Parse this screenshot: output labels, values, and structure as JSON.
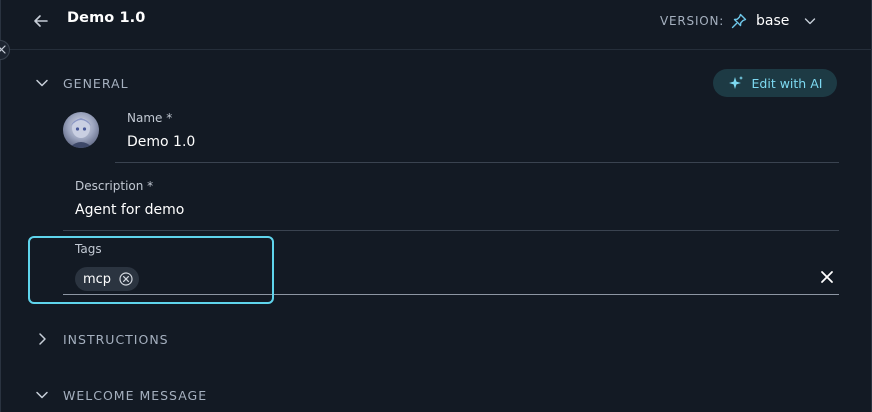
{
  "header": {
    "title": "Demo 1.0",
    "version_label": "VERSION:",
    "version_value": "base",
    "back_icon": "arrow-left-icon",
    "pin_icon": "pin-icon",
    "dropdown_icon": "chevron-down-icon"
  },
  "sections": {
    "general": "GENERAL",
    "instructions": "INSTRUCTIONS",
    "welcome": "WELCOME MESSAGE"
  },
  "edit_ai_label": "Edit with AI",
  "fields": {
    "name_label": "Name *",
    "name_value": "Demo 1.0",
    "description_label": "Description *",
    "description_value": "Agent for demo",
    "tags_label": "Tags",
    "tags": [
      "mcp"
    ]
  },
  "colors": {
    "background": "#131a24",
    "accent": "#5fd4ec",
    "ai_button_bg": "#1d3a44",
    "ai_button_text": "#7dd9f1"
  }
}
